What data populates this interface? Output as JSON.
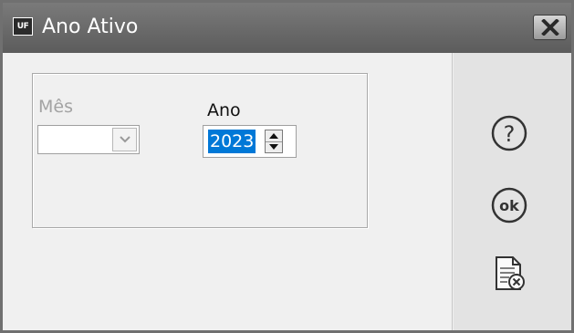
{
  "window": {
    "title": "Ano Ativo",
    "app_icon_text": "UF"
  },
  "form": {
    "month_label": "Mês",
    "month_value": "",
    "year_label": "Ano",
    "year_value": "2023"
  },
  "actions": [
    {
      "name": "help-icon",
      "label": "?"
    },
    {
      "name": "ok-icon",
      "label": "ok"
    },
    {
      "name": "cancel-document-icon",
      "label": ""
    }
  ],
  "colors": {
    "titlebar": "#6c6c6c",
    "selection": "#0078d7",
    "disabled_text": "#a3a3a3"
  }
}
